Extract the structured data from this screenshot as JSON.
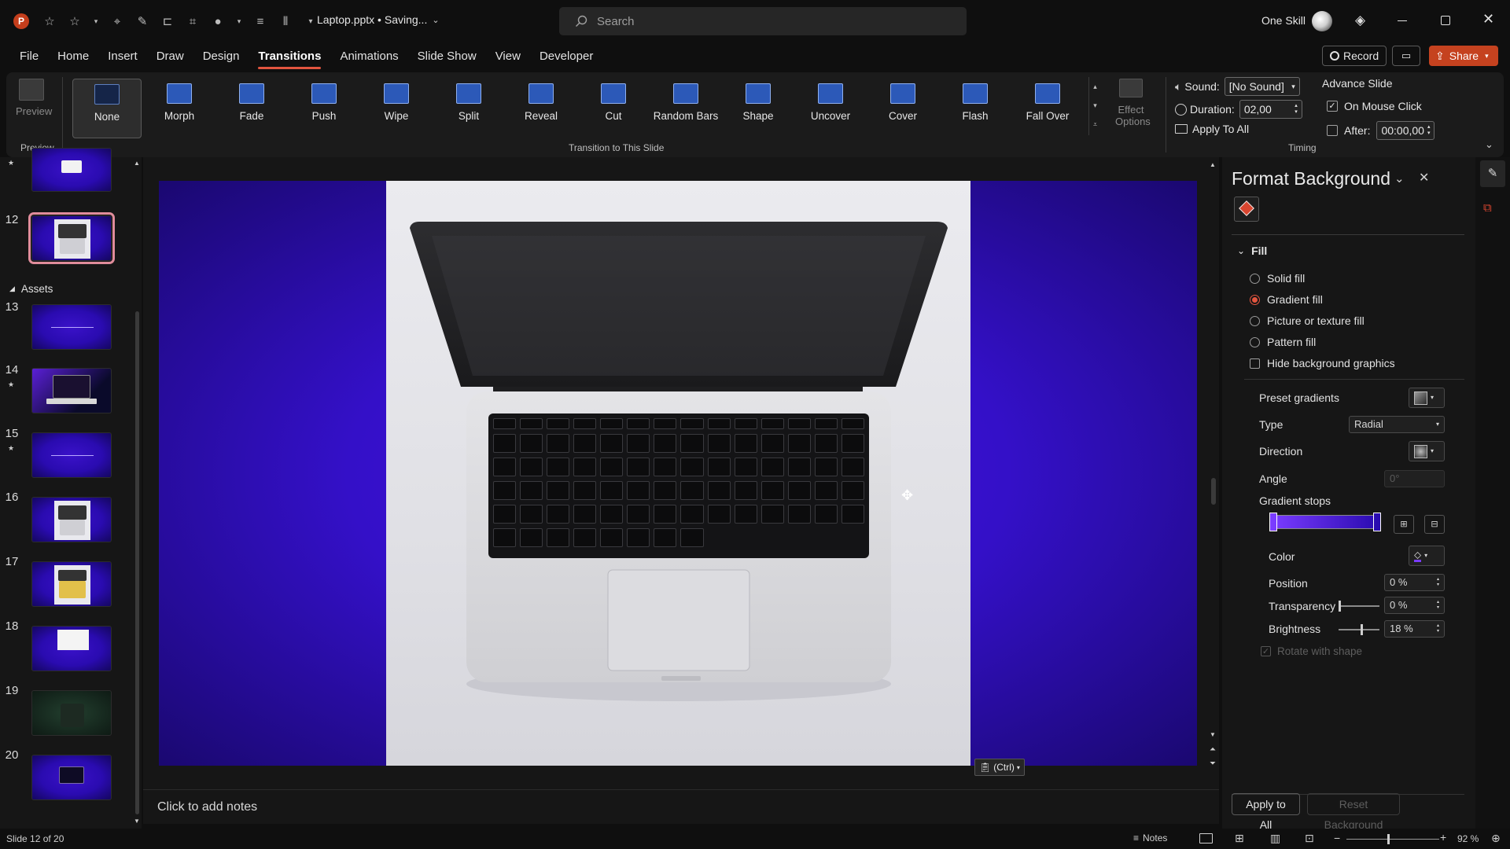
{
  "titlebar": {
    "file_title": "Laptop.pptx • Saving...",
    "search_placeholder": "Search",
    "user_name": "One Skill"
  },
  "menu": {
    "items": [
      "File",
      "Home",
      "Insert",
      "Draw",
      "Design",
      "Transitions",
      "Animations",
      "Slide Show",
      "View",
      "Developer"
    ],
    "active": "Transitions",
    "record_label": "Record",
    "share_label": "Share"
  },
  "ribbon": {
    "preview_label": "Preview",
    "preview_group_label": "Preview",
    "transitions": [
      "None",
      "Morph",
      "Fade",
      "Push",
      "Wipe",
      "Split",
      "Reveal",
      "Cut",
      "Random Bars",
      "Shape",
      "Uncover",
      "Cover",
      "Flash",
      "Fall Over"
    ],
    "selected_transition": "None",
    "effect_options_label": "Effect Options",
    "group_label": "Transition to This Slide",
    "timing": {
      "sound_label": "Sound:",
      "sound_value": "[No Sound]",
      "duration_label": "Duration:",
      "duration_value": "02,00",
      "apply_all_label": "Apply To All",
      "advance_slide_label": "Advance Slide",
      "on_mouse_click_label": "On Mouse Click",
      "on_mouse_click_checked": true,
      "after_label": "After:",
      "after_value": "00:00,00",
      "after_checked": false,
      "group_label": "Timing"
    }
  },
  "slides_panel": {
    "section_label": "Assets",
    "selected": 12,
    "slides": [
      {
        "num": "",
        "star": true
      },
      {
        "num": "12",
        "star": false
      },
      {
        "num": "13",
        "star": false
      },
      {
        "num": "14",
        "star": true
      },
      {
        "num": "15",
        "star": true
      },
      {
        "num": "16",
        "star": false
      },
      {
        "num": "17",
        "star": false
      },
      {
        "num": "18",
        "star": false
      },
      {
        "num": "19",
        "star": false
      },
      {
        "num": "20",
        "star": false
      }
    ]
  },
  "editor": {
    "paste_tag": "(Ctrl)",
    "notes_placeholder": "Click to add notes"
  },
  "format_background": {
    "title": "Format Background",
    "fill_section": "Fill",
    "fill_options": [
      "Solid fill",
      "Gradient fill",
      "Picture or texture fill",
      "Pattern fill"
    ],
    "selected_fill": "Gradient fill",
    "hide_bg_label": "Hide background graphics",
    "preset_gradients_label": "Preset gradients",
    "type_label": "Type",
    "type_value": "Radial",
    "direction_label": "Direction",
    "angle_label": "Angle",
    "angle_value": "0°",
    "gradient_stops_label": "Gradient stops",
    "color_label": "Color",
    "position_label": "Position",
    "position_value": "0 %",
    "transparency_label": "Transparency",
    "transparency_value": "0 %",
    "brightness_label": "Brightness",
    "brightness_value": "18 %",
    "rotate_label": "Rotate with shape",
    "apply_all_label": "Apply to All",
    "reset_label": "Reset Background",
    "colors": {
      "stop_start": "#7a3cff",
      "stop_end": "#2a0bb0"
    }
  },
  "statusbar": {
    "slide_info": "Slide 12 of 20",
    "notes_label": "Notes",
    "zoom": "92 %"
  },
  "colors": {
    "accent": "#e2553f",
    "slide_purple": "#3410c8"
  }
}
